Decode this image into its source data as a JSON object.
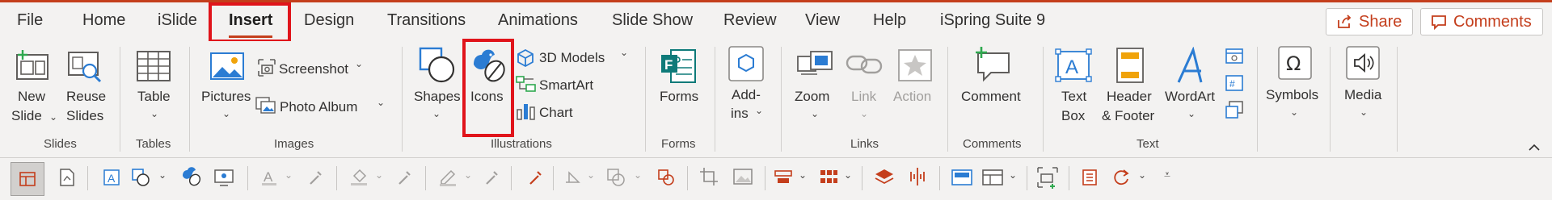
{
  "tabs": [
    "File",
    "Home",
    "iSlide",
    "Insert",
    "Design",
    "Transitions",
    "Animations",
    "Slide Show",
    "Review",
    "View",
    "Help",
    "iSpring Suite 9"
  ],
  "active_tab": "Insert",
  "share_label": "Share",
  "comments_label": "Comments",
  "groups": {
    "slides": {
      "label": "Slides",
      "new_slide_1": "New",
      "new_slide_2": "Slide",
      "reuse_1": "Reuse",
      "reuse_2": "Slides"
    },
    "tables": {
      "label": "Tables",
      "table": "Table"
    },
    "images": {
      "label": "Images",
      "pictures": "Pictures",
      "screenshot": "Screenshot",
      "photo_album": "Photo Album"
    },
    "illustrations": {
      "label": "Illustrations",
      "shapes": "Shapes",
      "icons": "Icons",
      "models3d": "3D Models",
      "smartart": "SmartArt",
      "chart": "Chart"
    },
    "forms": {
      "label": "Forms",
      "forms": "Forms"
    },
    "addins": {
      "line1": "Add-",
      "line2": "ins"
    },
    "links": {
      "label": "Links",
      "zoom": "Zoom",
      "link": "Link",
      "action": "Action"
    },
    "comments": {
      "label": "Comments",
      "comment": "Comment"
    },
    "text": {
      "label": "Text",
      "textbox_1": "Text",
      "textbox_2": "Box",
      "header_1": "Header",
      "header_2": "& Footer",
      "wordart": "WordArt"
    },
    "symbols": {
      "symbols": "Symbols"
    },
    "media": {
      "media": "Media"
    }
  },
  "colors": {
    "accent": "#c43e1c",
    "highlight": "#e0141b",
    "icon_blue": "#2b7cd3",
    "icon_teal": "#0e7a79"
  }
}
